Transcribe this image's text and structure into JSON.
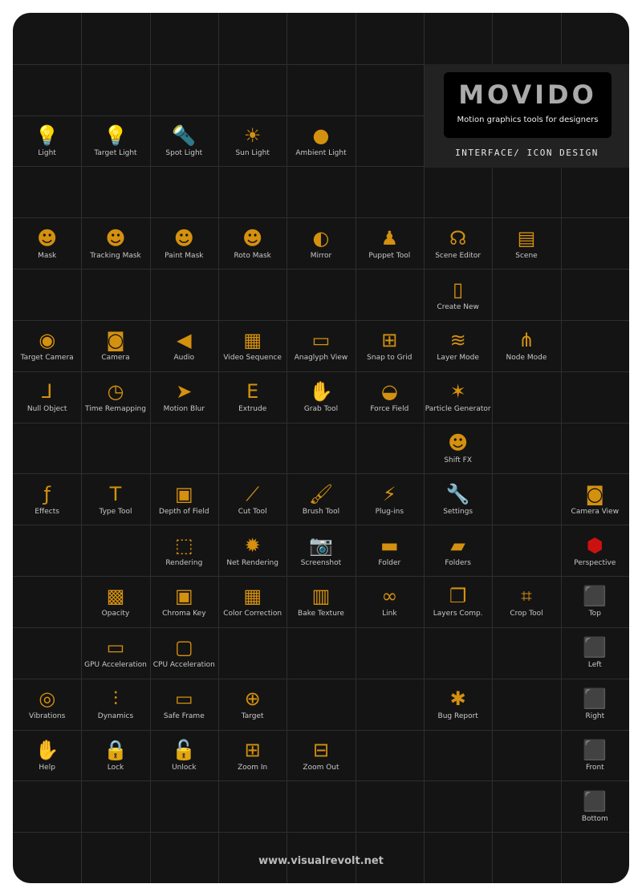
{
  "accent_color": "#d4900f",
  "logo": {
    "wordmark": "MOVIDO",
    "tagline": "Motion graphics tools for designers",
    "subtitle": "INTERFACE/ ICON DESIGN"
  },
  "footer": {
    "url": "www.visualrevolt.net"
  },
  "rows": [
    [
      null,
      null,
      null,
      null,
      null,
      null,
      null,
      null,
      null
    ],
    [
      null,
      null,
      null,
      null,
      null,
      null,
      null,
      null,
      null
    ],
    [
      {
        "label": "Light",
        "icon": "bulb-icon"
      },
      {
        "label": "Target Light",
        "icon": "target-bulb-icon"
      },
      {
        "label": "Spot Light",
        "icon": "flashlight-icon"
      },
      {
        "label": "Sun Light",
        "icon": "sun-icon"
      },
      {
        "label": "Ambient Light",
        "icon": "glow-icon"
      },
      null,
      null,
      null,
      null
    ],
    [
      null,
      null,
      null,
      null,
      null,
      null,
      null,
      null,
      null
    ],
    [
      {
        "label": "Mask",
        "icon": "mask-icon"
      },
      {
        "label": "Tracking Mask",
        "icon": "tracking-mask-icon"
      },
      {
        "label": "Paint Mask",
        "icon": "paint-mask-icon"
      },
      {
        "label": "Roto Mask",
        "icon": "roto-mask-icon"
      },
      {
        "label": "Mirror",
        "icon": "mirror-icon"
      },
      {
        "label": "Puppet Tool",
        "icon": "puppet-icon"
      },
      {
        "label": "Scene Editor",
        "icon": "scene-editor-icon"
      },
      {
        "label": "Scene",
        "icon": "clapperboard-icon"
      },
      null
    ],
    [
      null,
      null,
      null,
      null,
      null,
      null,
      {
        "label": "Create New",
        "icon": "new-document-icon"
      },
      null,
      null
    ],
    [
      {
        "label": "Target Camera",
        "icon": "target-camera-icon"
      },
      {
        "label": "Camera",
        "icon": "camera-icon"
      },
      {
        "label": "Audio",
        "icon": "speaker-icon"
      },
      {
        "label": "Video Sequence",
        "icon": "film-strip-icon"
      },
      {
        "label": "Anaglyph View",
        "icon": "3d-glasses-icon"
      },
      {
        "label": "Snap to Grid",
        "icon": "magnet-grid-icon"
      },
      {
        "label": "Layer Mode",
        "icon": "layers-icon"
      },
      {
        "label": "Node Mode",
        "icon": "nodes-icon"
      },
      null
    ],
    [
      {
        "label": "Null Object",
        "icon": "axes-icon"
      },
      {
        "label": "Time Remapping",
        "icon": "clock-icon"
      },
      {
        "label": "Motion Blur",
        "icon": "bullet-icon"
      },
      {
        "label": "Extrude",
        "icon": "extrude-icon"
      },
      {
        "label": "Grab Tool",
        "icon": "hand-icon"
      },
      {
        "label": "Force Field",
        "icon": "force-field-icon"
      },
      {
        "label": "Particle Generator",
        "icon": "particles-icon"
      },
      null,
      null
    ],
    [
      null,
      null,
      null,
      null,
      null,
      null,
      {
        "label": "Shift FX",
        "icon": "shift-fx-icon"
      },
      null,
      null
    ],
    [
      {
        "label": "Effects",
        "icon": "fx-icon"
      },
      {
        "label": "Type Tool",
        "icon": "type-icon"
      },
      {
        "label": "Depth of Field",
        "icon": "depth-of-field-icon"
      },
      {
        "label": "Cut Tool",
        "icon": "knife-icon"
      },
      {
        "label": "Brush Tool",
        "icon": "brush-icon"
      },
      {
        "label": "Plug-ins",
        "icon": "plug-icon"
      },
      {
        "label": "Settings",
        "icon": "wrench-icon"
      },
      null,
      {
        "label": "Camera View",
        "icon": "camera-view-icon"
      }
    ],
    [
      null,
      null,
      {
        "label": "Rendering",
        "icon": "render-icon"
      },
      {
        "label": "Net Rendering",
        "icon": "network-icon"
      },
      {
        "label": "Screenshot",
        "icon": "photo-camera-icon"
      },
      {
        "label": "Folder",
        "icon": "folder-icon"
      },
      {
        "label": "Folders",
        "icon": "folders-icon"
      },
      null,
      {
        "label": "Perspective",
        "icon": "cube-perspective-icon"
      }
    ],
    [
      null,
      {
        "label": "Opacity",
        "icon": "checkerboard-icon"
      },
      {
        "label": "Chroma Key",
        "icon": "chroma-key-icon"
      },
      {
        "label": "Color Correction",
        "icon": "color-grid-icon"
      },
      {
        "label": "Bake Texture",
        "icon": "oven-icon"
      },
      {
        "label": "Link",
        "icon": "link-icon"
      },
      {
        "label": "Layers Comp.",
        "icon": "layers-comp-icon"
      },
      {
        "label": "Crop Tool",
        "icon": "crop-icon"
      },
      {
        "label": "Top",
        "icon": "cube-top-icon"
      }
    ],
    [
      null,
      {
        "label": "GPU Acceleration",
        "icon": "gpu-icon"
      },
      {
        "label": "CPU Acceleration",
        "icon": "cpu-icon"
      },
      null,
      null,
      null,
      null,
      null,
      {
        "label": "Left",
        "icon": "cube-left-icon"
      }
    ],
    [
      {
        "label": "Vibrations",
        "icon": "vibration-icon"
      },
      {
        "label": "Dynamics",
        "icon": "pendulum-icon"
      },
      {
        "label": "Safe Frame",
        "icon": "safe-frame-icon"
      },
      {
        "label": "Target",
        "icon": "target-icon"
      },
      null,
      null,
      {
        "label": "Bug Report",
        "icon": "bug-icon"
      },
      null,
      {
        "label": "Right",
        "icon": "cube-right-icon"
      }
    ],
    [
      {
        "label": "Help",
        "icon": "drowning-hand-icon"
      },
      {
        "label": "Lock",
        "icon": "lock-icon"
      },
      {
        "label": "Unlock",
        "icon": "unlock-icon"
      },
      {
        "label": "Zoom In",
        "icon": "zoom-in-icon"
      },
      {
        "label": "Zoom Out",
        "icon": "zoom-out-icon"
      },
      null,
      null,
      null,
      {
        "label": "Front",
        "icon": "cube-front-icon"
      }
    ],
    [
      null,
      null,
      null,
      null,
      null,
      null,
      null,
      null,
      {
        "label": "Bottom",
        "icon": "cube-bottom-icon"
      }
    ],
    [
      null,
      null,
      null,
      null,
      null,
      null,
      null,
      null,
      null
    ]
  ]
}
